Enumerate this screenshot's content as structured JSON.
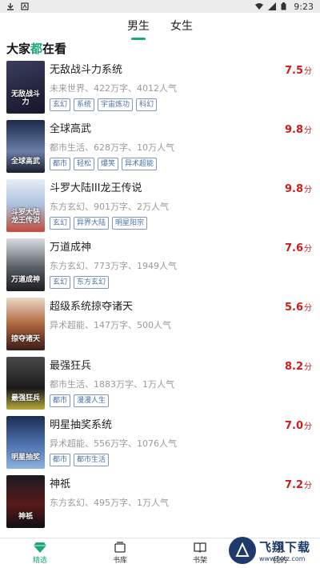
{
  "status": {
    "time": "9:23"
  },
  "tabs": [
    {
      "label": "男生",
      "active": true
    },
    {
      "label": "女生",
      "active": false
    }
  ],
  "section": {
    "title_pre": "大家",
    "title_hl": "都",
    "title_post": "在看"
  },
  "books": [
    {
      "title": "无敌战斗力系统",
      "meta": "未来世界、422万字、4012人气",
      "tags": [
        "玄幻",
        "系统",
        "宇宙炼功",
        "科幻"
      ],
      "score": "7.5",
      "cover_text": "无敌战斗力",
      "cover_color": "#23253a"
    },
    {
      "title": "全球高武",
      "meta": "都市生活、628万字、10万人气",
      "tags": [
        "都市",
        "轻松",
        "爆笑",
        "异术超能"
      ],
      "score": "9.8",
      "cover_text": "全球高武",
      "cover_color": "#2a3b5c"
    },
    {
      "title": "斗罗大陆III龙王传说",
      "meta": "东方玄幻、901万字、2万人气",
      "tags": [
        "玄幻",
        "异界大陆",
        "明星阳宗"
      ],
      "score": "9.8",
      "cover_text": "斗罗大陆 龙王传说",
      "cover_color": "#c9d7e8"
    },
    {
      "title": "万道成神",
      "meta": "东方玄幻、773万字、1949人气",
      "tags": [
        "玄幻",
        "东方玄幻"
      ],
      "score": "7.6",
      "cover_text": "万道成神",
      "cover_color": "#3b3f45"
    },
    {
      "title": "超级系统掠夺诸天",
      "meta": "异术超能、147万字、500人气",
      "tags": [],
      "score": "5.6",
      "cover_text": "掠夺诸天",
      "cover_color": "#7b3a2a"
    },
    {
      "title": "最强狂兵",
      "meta": "都市生活、1883万字、1万人气",
      "tags": [
        "都市",
        "漫漫人生"
      ],
      "score": "8.2",
      "cover_text": "最强狂兵",
      "cover_color": "#2b2b2b"
    },
    {
      "title": "明星抽奖系统",
      "meta": "异术超能、556万字、1076人气",
      "tags": [
        "都市",
        "都市生活"
      ],
      "score": "7.0",
      "cover_text": "明星抽奖",
      "cover_color": "#2c4a7a"
    },
    {
      "title": "神祇",
      "meta": "东方玄幻、495万字、1万人气",
      "tags": [],
      "score": "7.2",
      "cover_text": "神祇",
      "cover_color": "#1a1a22"
    }
  ],
  "score_unit": "分",
  "bottom_nav": [
    {
      "label": "精选",
      "icon": "gem-icon",
      "active": true
    },
    {
      "label": "书库",
      "icon": "library-icon",
      "active": false
    },
    {
      "label": "书架",
      "icon": "book-icon",
      "active": false
    },
    {
      "label": "我的",
      "icon": "user-icon",
      "active": false
    }
  ],
  "watermark": {
    "cn": "飞翔下载",
    "en": "www.fxxz.com"
  },
  "colors": {
    "accent": "#1aa77c",
    "score": "#d11a1a",
    "tag": "#4a6fa5"
  }
}
